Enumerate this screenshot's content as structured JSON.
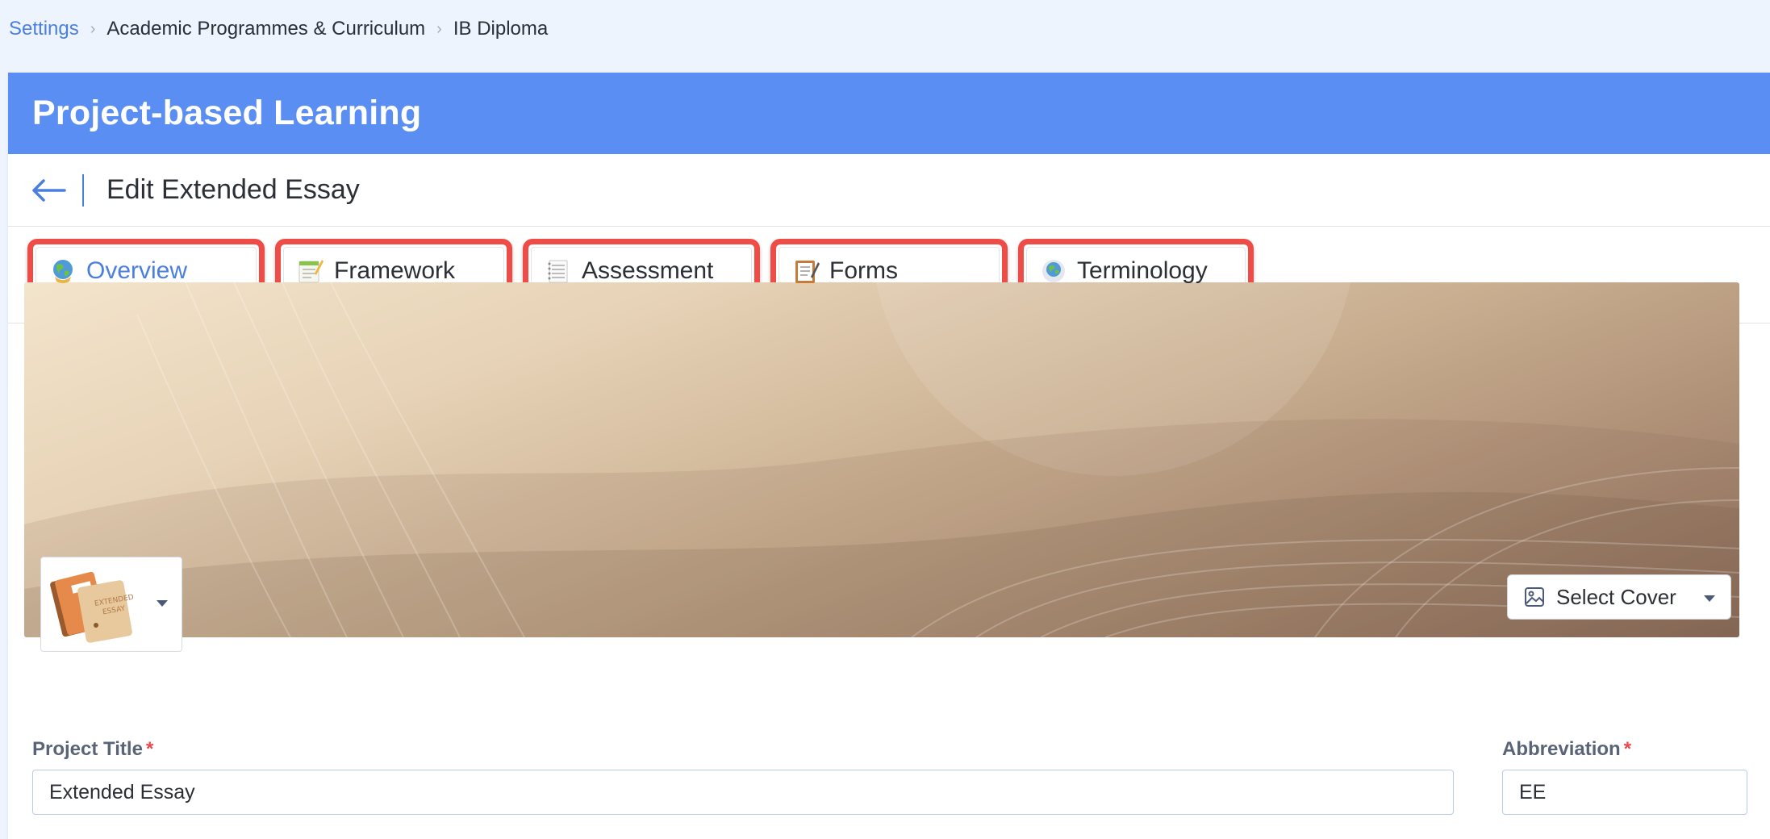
{
  "breadcrumb": {
    "items": [
      "Settings",
      "Academic Programmes & Curriculum",
      "IB Diploma"
    ]
  },
  "header": {
    "title": "Project-based Learning"
  },
  "subheader": {
    "title": "Edit Extended Essay"
  },
  "tabs": [
    {
      "label": "Overview",
      "icon": "globe-icon",
      "active": true
    },
    {
      "label": "Framework",
      "icon": "memo-icon",
      "active": false
    },
    {
      "label": "Assessment",
      "icon": "notepad-icon",
      "active": false
    },
    {
      "label": "Forms",
      "icon": "clipboard-icon",
      "active": false
    },
    {
      "label": "Terminology",
      "icon": "globe-icon",
      "active": false
    }
  ],
  "cover": {
    "select_label": "Select Cover"
  },
  "form": {
    "project_title_label": "Project Title",
    "project_title_value": "Extended Essay",
    "abbreviation_label": "Abbreviation",
    "abbreviation_value": "EE",
    "required_mark": "*"
  },
  "colors": {
    "header": "#5b8ef2",
    "accent": "#4a7fe0",
    "highlight": "#ef4c47"
  }
}
